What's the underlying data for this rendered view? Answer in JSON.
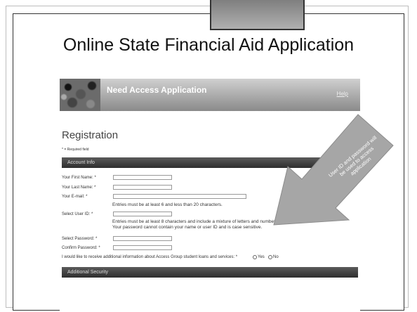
{
  "slide": {
    "title": "Online State Financial Aid Application"
  },
  "screenshot": {
    "banner_title": "Need Access Application",
    "help_link": "Help",
    "registration_title": "Registration",
    "required_note": "* = Required field",
    "account_section": "Account Info",
    "security_section": "Additional Security",
    "fields": {
      "first_name": "Your First Name: *",
      "last_name": "Your Last Name: *",
      "email": "Your E-mail: *",
      "email_hint": "Entries must be at least 6 and less than 20 characters.",
      "user_id": "Select User ID: *",
      "user_id_hint_1": "Entries must be at least 8 characters and include a mixture of letters and numbers.",
      "user_id_hint_2": "Your password cannot contain your name or user ID and is case sensitive.",
      "password": "Select Password: *",
      "confirm_password": "Confirm Password: *",
      "marketing_question": "I would like to receive additional information about Access Group student loans and services: *",
      "option_yes": "Yes",
      "option_no": "No"
    }
  },
  "annotation": {
    "line_1": "User ID and password will",
    "line_2": "be used to access",
    "line_3": "application"
  },
  "colors": {
    "section_bar": "#3a3a3a",
    "arrow": "#a6a6a6"
  }
}
